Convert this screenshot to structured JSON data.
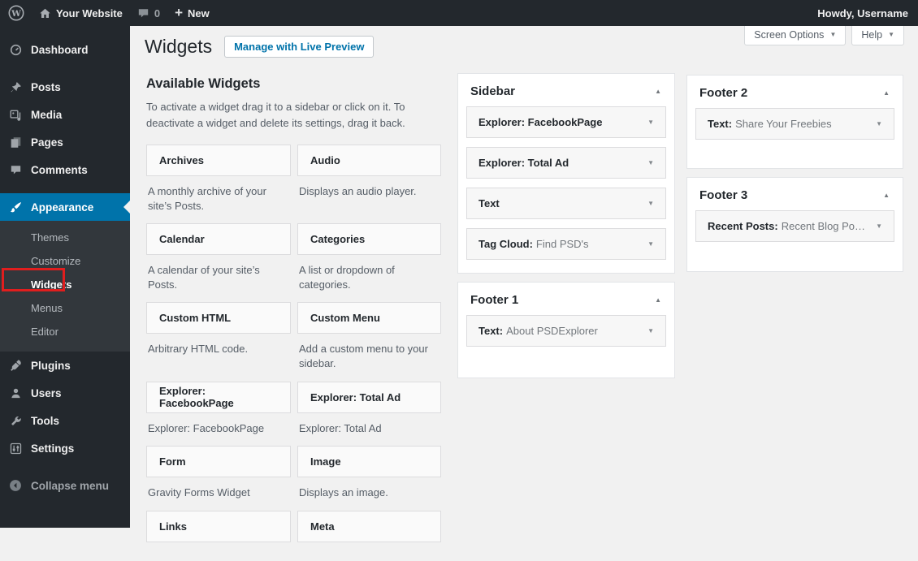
{
  "colors": {
    "accent_blue": "#0073aa",
    "admin_dark": "#23282d",
    "submenu_dark": "#32373c",
    "content_bg": "#f1f1f1",
    "annotation_red": "#e01e1e"
  },
  "icons": {
    "panel_collapse_glyph": "▲",
    "row_toggle_glyph": "▼",
    "dropdown_caret_glyph": "▼",
    "new_plus_glyph": "+"
  },
  "admin_bar": {
    "site_name": "Your Website",
    "comments_count": "0",
    "new_label": "New",
    "howdy": "Howdy, Username"
  },
  "screen_meta": {
    "screen_options": "Screen Options",
    "help": "Help"
  },
  "menu": {
    "items": [
      "Dashboard",
      "Posts",
      "Media",
      "Pages",
      "Comments",
      "Appearance",
      "Plugins",
      "Users",
      "Tools",
      "Settings"
    ],
    "appearance_submenu": [
      "Themes",
      "Customize",
      "Widgets",
      "Menus",
      "Editor"
    ],
    "collapse_label": "Collapse menu"
  },
  "page": {
    "title": "Widgets",
    "manage_button": "Manage with Live Preview"
  },
  "available_widgets": {
    "heading": "Available Widgets",
    "description": "To activate a widget drag it to a sidebar or click on it. To deactivate a widget and delete its settings, drag it back.",
    "items": [
      {
        "name": "Archives",
        "desc": "A monthly archive of your site’s Posts."
      },
      {
        "name": "Audio",
        "desc": "Displays an audio player."
      },
      {
        "name": "Calendar",
        "desc": "A calendar of your site’s Posts."
      },
      {
        "name": "Categories",
        "desc": "A list or dropdown of categories."
      },
      {
        "name": "Custom HTML",
        "desc": "Arbitrary HTML code."
      },
      {
        "name": "Custom Menu",
        "desc": "Add a custom menu to your sidebar."
      },
      {
        "name": "Explorer: FacebookPage",
        "desc": "Explorer: FacebookPage"
      },
      {
        "name": "Explorer: Total Ad",
        "desc": "Explorer: Total Ad"
      },
      {
        "name": "Form",
        "desc": "Gravity Forms Widget"
      },
      {
        "name": "Image",
        "desc": "Displays an image."
      },
      {
        "name": "Links",
        "desc": ""
      },
      {
        "name": "Meta",
        "desc": ""
      }
    ]
  },
  "widget_areas": [
    {
      "title": "Sidebar",
      "widgets": [
        {
          "name": "Explorer: FacebookPage",
          "subtitle": ""
        },
        {
          "name": "Explorer: Total Ad",
          "subtitle": ""
        },
        {
          "name": "Text",
          "subtitle": ""
        },
        {
          "name": "Tag Cloud:",
          "subtitle": "Find PSD's"
        }
      ]
    },
    {
      "title": "Footer 1",
      "widgets": [
        {
          "name": "Text:",
          "subtitle": "About PSDExplorer"
        }
      ]
    },
    {
      "title": "Footer 2",
      "widgets": [
        {
          "name": "Text:",
          "subtitle": "Share Your Freebies"
        }
      ]
    },
    {
      "title": "Footer 3",
      "widgets": [
        {
          "name": "Recent Posts:",
          "subtitle": "Recent Blog Po…"
        }
      ]
    }
  ]
}
